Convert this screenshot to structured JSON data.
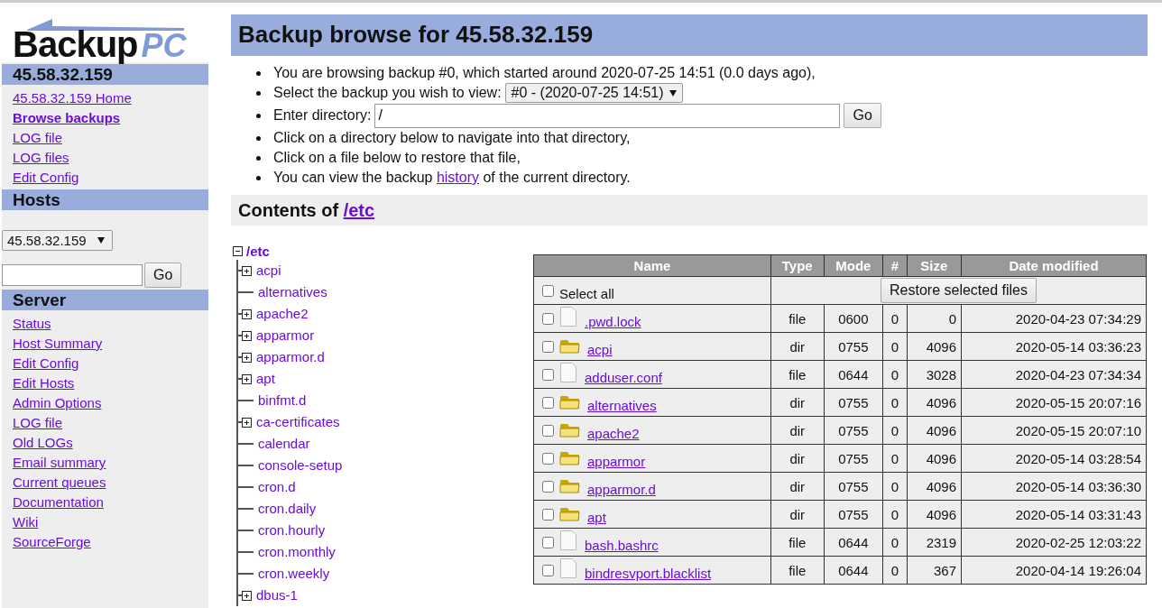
{
  "sidebar": {
    "logo": {
      "brand": "Backup",
      "suffix": "PC"
    },
    "host_section": {
      "title": "45.58.32.159",
      "links": [
        {
          "label": "45.58.32.159 Home",
          "selected": false
        },
        {
          "label": "Browse backups",
          "selected": true
        },
        {
          "label": "LOG file",
          "selected": false
        },
        {
          "label": "LOG files",
          "selected": false
        },
        {
          "label": "Edit Config",
          "selected": false
        }
      ]
    },
    "hosts_section": {
      "title": "Hosts",
      "host_select": "45.58.32.159",
      "search_button": "Go"
    },
    "server_section": {
      "title": "Server",
      "links": [
        {
          "label": "Status",
          "selected": false
        },
        {
          "label": "Host Summary",
          "selected": false
        },
        {
          "label": "Edit Config",
          "selected": false
        },
        {
          "label": "Edit Hosts",
          "selected": false
        },
        {
          "label": "Admin Options",
          "selected": false
        },
        {
          "label": "LOG file",
          "selected": false
        },
        {
          "label": "Old LOGs",
          "selected": false
        },
        {
          "label": "Email summary",
          "selected": false
        },
        {
          "label": "Current queues",
          "selected": false
        },
        {
          "label": "Documentation",
          "selected": false
        },
        {
          "label": "Wiki",
          "selected": false
        },
        {
          "label": "SourceForge",
          "selected": false
        }
      ]
    }
  },
  "main": {
    "title": "Backup browse for 45.58.32.159",
    "info": [
      {
        "kind": "text",
        "text": "You are browsing backup #0, which started around 2020-07-25 14:51 (0.0 days ago),"
      },
      {
        "kind": "select",
        "text": "Select the backup you wish to view:",
        "value": "#0 - (2020-07-25 14:51)"
      },
      {
        "kind": "input",
        "text": "Enter directory:",
        "value": "/",
        "button": "Go"
      },
      {
        "kind": "text",
        "text": "Click on a directory below to navigate into that directory,"
      },
      {
        "kind": "text",
        "text": "Click on a file below to restore that file,"
      },
      {
        "kind": "link",
        "text": "You can view the backup",
        "link": "history",
        "after": "of the current directory."
      }
    ],
    "contents": {
      "label": "Contents of",
      "path": "/etc"
    },
    "tree": {
      "label": "/etc",
      "expanded": true,
      "children": [
        {
          "label": "acpi",
          "collapsed": true
        },
        {
          "label": "alternatives",
          "collapsed": false
        },
        {
          "label": "apache2",
          "collapsed": true
        },
        {
          "label": "apparmor",
          "collapsed": true
        },
        {
          "label": "apparmor.d",
          "collapsed": true
        },
        {
          "label": "apt",
          "collapsed": true
        },
        {
          "label": "binfmt.d",
          "collapsed": false
        },
        {
          "label": "ca-certificates",
          "collapsed": true
        },
        {
          "label": "calendar",
          "collapsed": false
        },
        {
          "label": "console-setup",
          "collapsed": false
        },
        {
          "label": "cron.d",
          "collapsed": false
        },
        {
          "label": "cron.daily",
          "collapsed": false
        },
        {
          "label": "cron.hourly",
          "collapsed": false
        },
        {
          "label": "cron.monthly",
          "collapsed": false
        },
        {
          "label": "cron.weekly",
          "collapsed": false
        },
        {
          "label": "dbus-1",
          "collapsed": true
        }
      ]
    },
    "table": {
      "columns": [
        "Name",
        "Type",
        "Mode",
        "#",
        "Size",
        "Date modified"
      ],
      "select_all": {
        "label": "Select all",
        "checked": false
      },
      "restore_button": "Restore selected files",
      "rows": [
        {
          "kind": "file",
          "checked": false,
          "name": ".pwd.lock",
          "type": "file",
          "mode": "0600",
          "count": "0",
          "size": "0",
          "date": "2020-04-23 07:34:29"
        },
        {
          "kind": "dir",
          "checked": false,
          "name": "acpi",
          "type": "dir",
          "mode": "0755",
          "count": "0",
          "size": "4096",
          "date": "2020-05-14 03:36:23"
        },
        {
          "kind": "file",
          "checked": false,
          "name": "adduser.conf",
          "type": "file",
          "mode": "0644",
          "count": "0",
          "size": "3028",
          "date": "2020-04-23 07:34:34"
        },
        {
          "kind": "dir",
          "checked": false,
          "name": "alternatives",
          "type": "dir",
          "mode": "0755",
          "count": "0",
          "size": "4096",
          "date": "2020-05-15 20:07:16"
        },
        {
          "kind": "dir",
          "checked": false,
          "name": "apache2",
          "type": "dir",
          "mode": "0755",
          "count": "0",
          "size": "4096",
          "date": "2020-05-15 20:07:10"
        },
        {
          "kind": "dir",
          "checked": false,
          "name": "apparmor",
          "type": "dir",
          "mode": "0755",
          "count": "0",
          "size": "4096",
          "date": "2020-05-14 03:28:54"
        },
        {
          "kind": "dir",
          "checked": false,
          "name": "apparmor.d",
          "type": "dir",
          "mode": "0755",
          "count": "0",
          "size": "4096",
          "date": "2020-05-14 03:36:30"
        },
        {
          "kind": "dir",
          "checked": false,
          "name": "apt",
          "type": "dir",
          "mode": "0755",
          "count": "0",
          "size": "4096",
          "date": "2020-05-14 03:31:43"
        },
        {
          "kind": "file",
          "checked": false,
          "name": "bash.bashrc",
          "type": "file",
          "mode": "0644",
          "count": "0",
          "size": "2319",
          "date": "2020-02-25 12:03:22"
        },
        {
          "kind": "file",
          "checked": false,
          "name": "bindresvport.blacklist",
          "type": "file",
          "mode": "0644",
          "count": "0",
          "size": "367",
          "date": "2020-04-14 19:26:04"
        }
      ]
    }
  }
}
